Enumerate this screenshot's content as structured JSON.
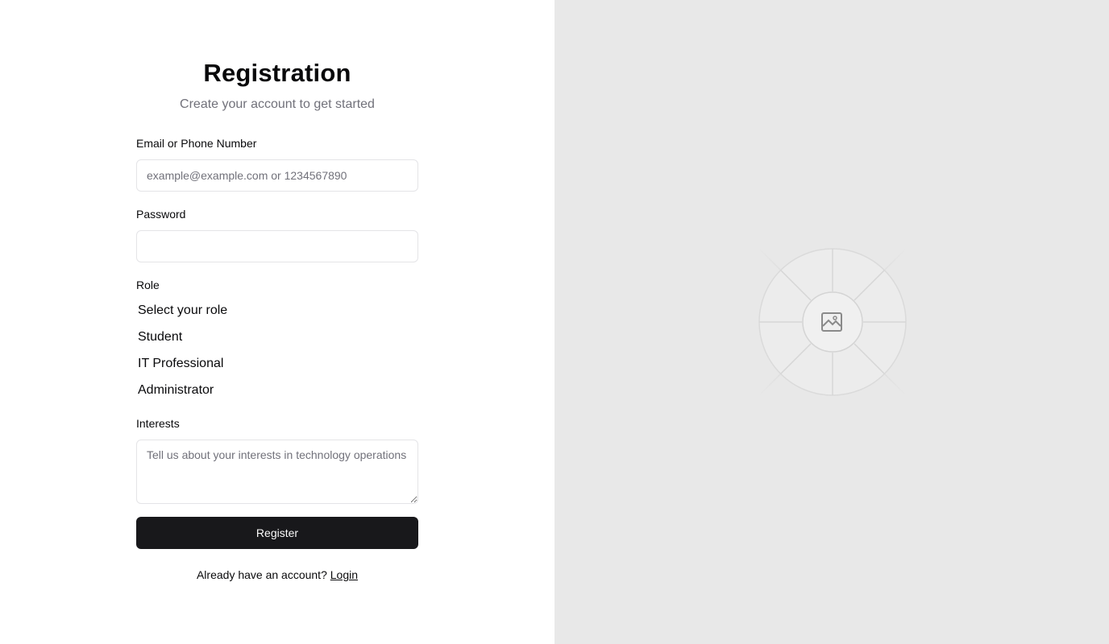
{
  "form": {
    "title": "Registration",
    "subtitle": "Create your account to get started",
    "email_label": "Email or Phone Number",
    "email_placeholder": "example@example.com or 1234567890",
    "email_value": "",
    "password_label": "Password",
    "password_value": "",
    "role_label": "Role",
    "role_options": [
      "Select your role",
      "Student",
      "IT Professional",
      "Administrator"
    ],
    "interests_label": "Interests",
    "interests_placeholder": "Tell us about your interests in technology operations",
    "interests_value": "",
    "submit_label": "Register",
    "footer_text": "Already have an account?",
    "login_link": "Login"
  },
  "image_panel": {
    "icon": "image-placeholder-icon",
    "background": "#e8e8e8"
  },
  "colors": {
    "button_bg": "#18181b",
    "button_text": "#fafafa",
    "muted_text": "#71717a",
    "border": "#e4e4e7"
  }
}
